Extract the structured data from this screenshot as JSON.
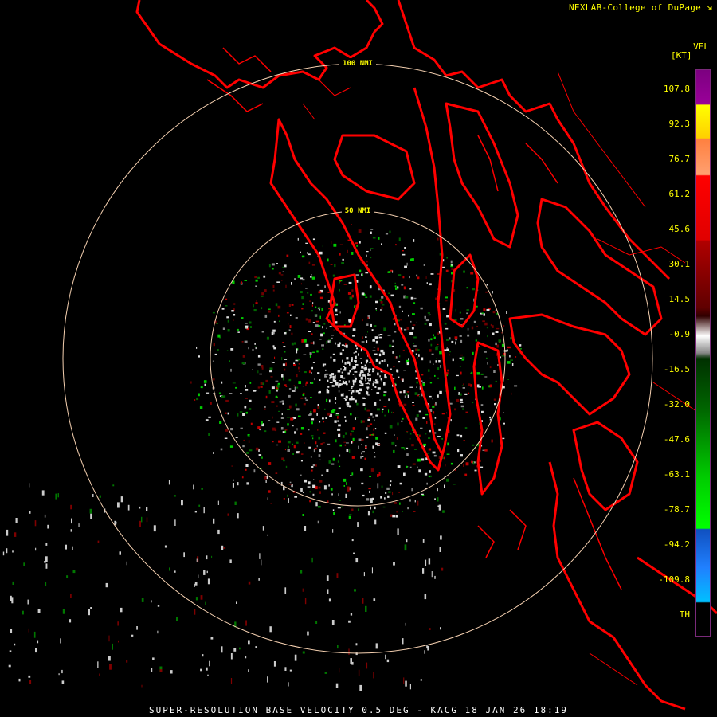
{
  "header": {
    "credit": "NEXLAB-College of DuPage",
    "credit_icon": "external-link-icon"
  },
  "legend": {
    "product": "VEL",
    "unit": "[KT]",
    "ticks": [
      "107.8",
      "92.3",
      "76.7",
      "61.2",
      "45.6",
      "30.1",
      "14.5",
      "-0.9",
      "-16.5",
      "-32.0",
      "-47.6",
      "-63.1",
      "-78.7",
      "-94.2",
      "-109.8",
      "TH"
    ]
  },
  "range_rings": {
    "outer": "100 NMI",
    "inner": "50 NMI"
  },
  "footer": {
    "caption": "SUPER-RESOLUTION BASE VELOCITY 0.5 DEG - KACG 18 JAN 26 18:19"
  },
  "colors": {
    "coastline": "#ff0000",
    "ring": "#f5d0b0",
    "label": "#ffff00",
    "inbound": "#00cc00",
    "outbound": "#c00000",
    "near_zero": "#dddddd"
  }
}
